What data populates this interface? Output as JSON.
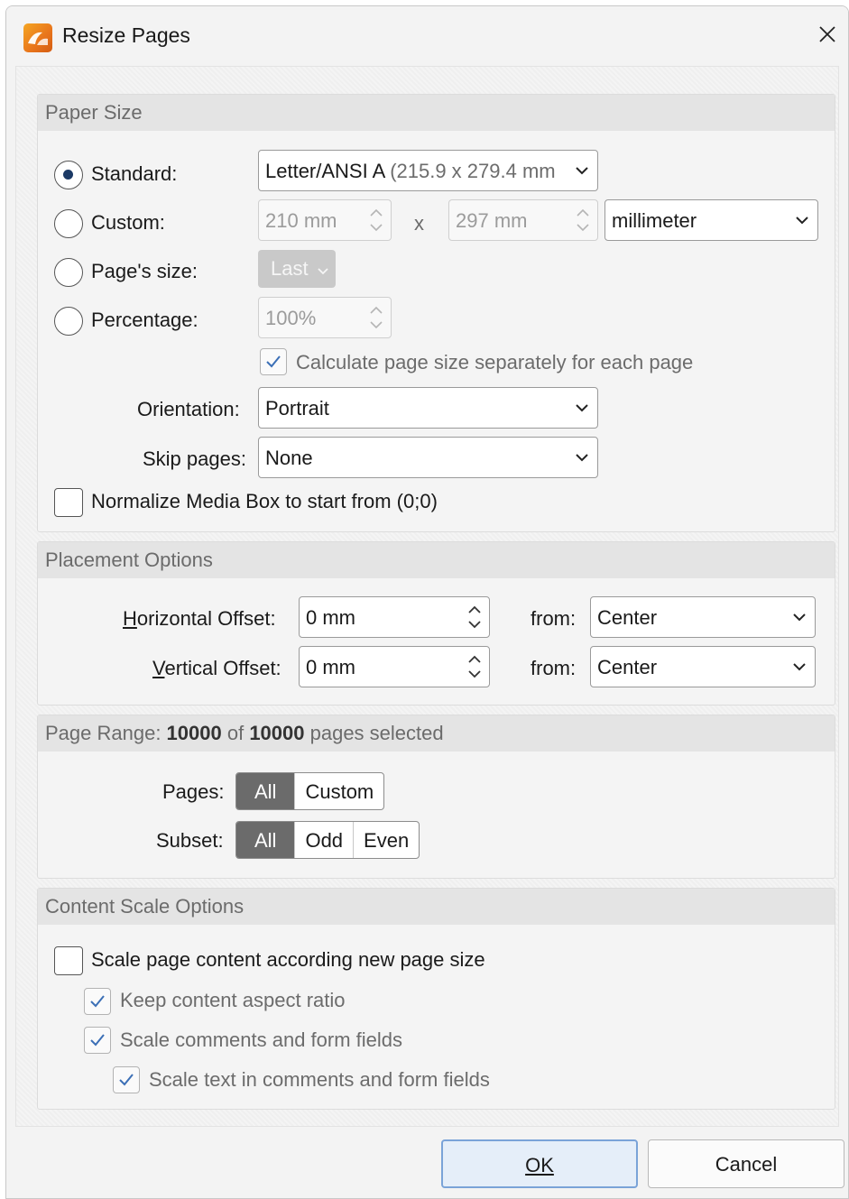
{
  "window": {
    "title": "Resize Pages"
  },
  "paper_size": {
    "header": "Paper Size",
    "standard_label": "Standard:",
    "custom_label": "Custom:",
    "pages_size_label": "Page's size:",
    "percentage_label": "Percentage:",
    "standard_value_main": "Letter/ANSI A",
    "standard_value_dim": " (215.9 x 279.4 mm",
    "custom_width": "210 mm",
    "times_sign": "x",
    "custom_height": "297 mm",
    "unit_value": "millimeter",
    "pages_size_button": "Last",
    "percentage_value": "100%",
    "calc_separately_label": "Calculate page size separately for each page",
    "orientation_label": "Orientation:",
    "orientation_value": "Portrait",
    "skip_pages_label": "Skip pages:",
    "skip_pages_value": "None",
    "normalize_label": "Normalize Media Box to start from (0;0)"
  },
  "placement": {
    "header": "Placement Options",
    "h_offset_label_u": "H",
    "h_offset_label_rest": "orizontal Offset:",
    "h_offset_value": "0 mm",
    "v_offset_label_u": "V",
    "v_offset_label_rest": "ertical Offset:",
    "v_offset_value": "0 mm",
    "from_label": "from:",
    "h_from_value": "Center",
    "v_from_value": "Center"
  },
  "page_range": {
    "header_prefix": "Page Range: ",
    "selected_count": "10000",
    "of_word": " of ",
    "total_count": "10000",
    "header_suffix": " pages selected",
    "pages_label": "Pages:",
    "subset_label": "Subset:",
    "pages_all": "All",
    "pages_custom": "Custom",
    "subset_all": "All",
    "subset_odd": "Odd",
    "subset_even": "Even"
  },
  "content_scale": {
    "header": "Content Scale Options",
    "scale_content_label": "Scale page content according new page size",
    "keep_aspect_label": "Keep content aspect ratio",
    "scale_comments_label": "Scale comments and form fields",
    "scale_text_label": "Scale text in comments and form fields"
  },
  "footer": {
    "ok_label": "OK",
    "cancel_label": "Cancel"
  },
  "colors": {
    "accent": "#1c3a66",
    "primary_button_border": "#7aa3d8",
    "segment_active": "#6b6b6b"
  }
}
